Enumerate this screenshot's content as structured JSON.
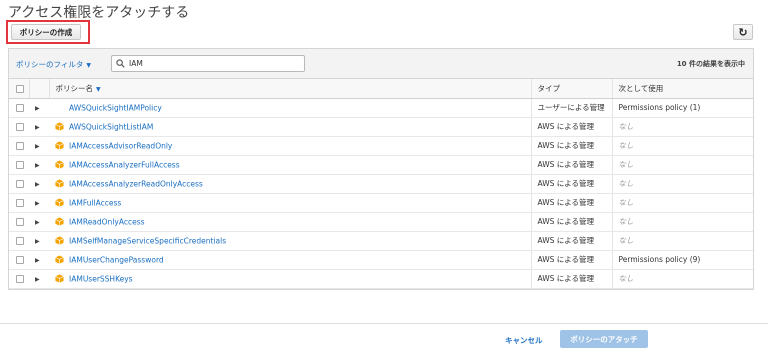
{
  "header": {
    "title": "アクセス権限をアタッチする",
    "create_policy_label": "ポリシーの作成",
    "refresh_icon": "refresh-icon"
  },
  "toolbar": {
    "filter_label": "ポリシーのフィルタ",
    "search_value": "IAM",
    "result_count": "10 件の結果を表示中"
  },
  "table": {
    "columns": [
      "ポリシー名",
      "タイプ",
      "次として使用"
    ],
    "rows": [
      {
        "name": "AWSQuickSightIAMPolicy",
        "type": "ユーザーによる管理",
        "usage": "Permissions policy (1)",
        "aws_managed": false
      },
      {
        "name": "AWSQuickSightListIAM",
        "type": "AWS による管理",
        "usage": "なし",
        "aws_managed": true
      },
      {
        "name": "IAMAccessAdvisorReadOnly",
        "type": "AWS による管理",
        "usage": "なし",
        "aws_managed": true
      },
      {
        "name": "IAMAccessAnalyzerFullAccess",
        "type": "AWS による管理",
        "usage": "なし",
        "aws_managed": true
      },
      {
        "name": "IAMAccessAnalyzerReadOnlyAccess",
        "type": "AWS による管理",
        "usage": "なし",
        "aws_managed": true
      },
      {
        "name": "IAMFullAccess",
        "type": "AWS による管理",
        "usage": "なし",
        "aws_managed": true
      },
      {
        "name": "IAMReadOnlyAccess",
        "type": "AWS による管理",
        "usage": "なし",
        "aws_managed": true
      },
      {
        "name": "IAMSelfManageServiceSpecificCredentials",
        "type": "AWS による管理",
        "usage": "なし",
        "aws_managed": true
      },
      {
        "name": "IAMUserChangePassword",
        "type": "AWS による管理",
        "usage": "Permissions policy (9)",
        "aws_managed": true
      },
      {
        "name": "IAMUserSSHKeys",
        "type": "AWS による管理",
        "usage": "なし",
        "aws_managed": true
      }
    ]
  },
  "footer": {
    "cancel_label": "キャンセル",
    "attach_label": "ポリシーのアタッチ"
  },
  "colors": {
    "link": "#1a6fc2",
    "highlight": "#e2343b",
    "aws_icon": "#f4a300",
    "attach_button": "#9fc3e6"
  }
}
